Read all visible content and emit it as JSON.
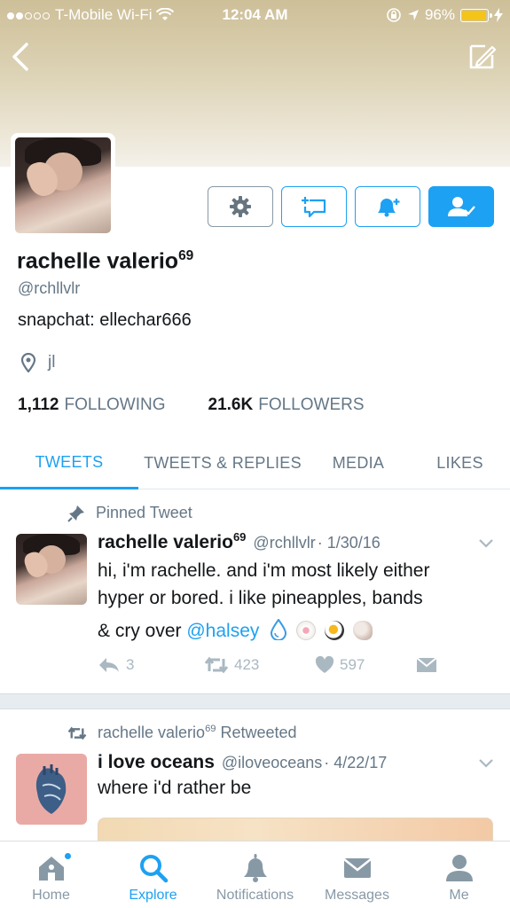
{
  "status_bar": {
    "carrier": "T-Mobile Wi-Fi",
    "time": "12:04 AM",
    "battery": "96%",
    "signal_dots_filled": 2,
    "signal_dots_total": 5
  },
  "profile": {
    "name": "rachelle valerio",
    "name_superscript": "69",
    "handle": "@rchllvlr",
    "bio": "snapchat: ellechar666",
    "location": "jl",
    "following_count": "1,112",
    "following_label": "FOLLOWING",
    "followers_count": "21.6K",
    "followers_label": "FOLLOWERS"
  },
  "tabs": [
    {
      "label": "TWEETS",
      "active": true
    },
    {
      "label": "TWEETS & REPLIES",
      "active": false
    },
    {
      "label": "MEDIA",
      "active": false
    },
    {
      "label": "LIKES",
      "active": false
    }
  ],
  "pinned_tweet": {
    "label": "Pinned Tweet",
    "name": "rachelle valerio",
    "name_superscript": "69",
    "handle": "@rchllvlr",
    "date": "· 1/30/16",
    "text_line1": "hi, i'm rachelle. and i'm most likely either",
    "text_line2": "hyper or bored. i like pineapples, bands",
    "text_line3": "& cry over ",
    "mention": "@halsey",
    "replies": "3",
    "retweets": "423",
    "likes": "597"
  },
  "retweet": {
    "retweeter": "rachelle valerio",
    "retweeter_superscript": "69",
    "label": "Retweeted",
    "name": "i love oceans",
    "handle": "@iloveoceans",
    "date": "· 4/22/17",
    "text": "where i'd rather be"
  },
  "tabbar": [
    {
      "label": "Home",
      "icon": "home-icon"
    },
    {
      "label": "Explore",
      "icon": "search-icon"
    },
    {
      "label": "Notifications",
      "icon": "bell-icon"
    },
    {
      "label": "Messages",
      "icon": "envelope-icon"
    },
    {
      "label": "Me",
      "icon": "person-icon"
    }
  ],
  "colors": {
    "accent": "#1da1f2",
    "muted": "#657786",
    "battery": "#f5c419"
  }
}
